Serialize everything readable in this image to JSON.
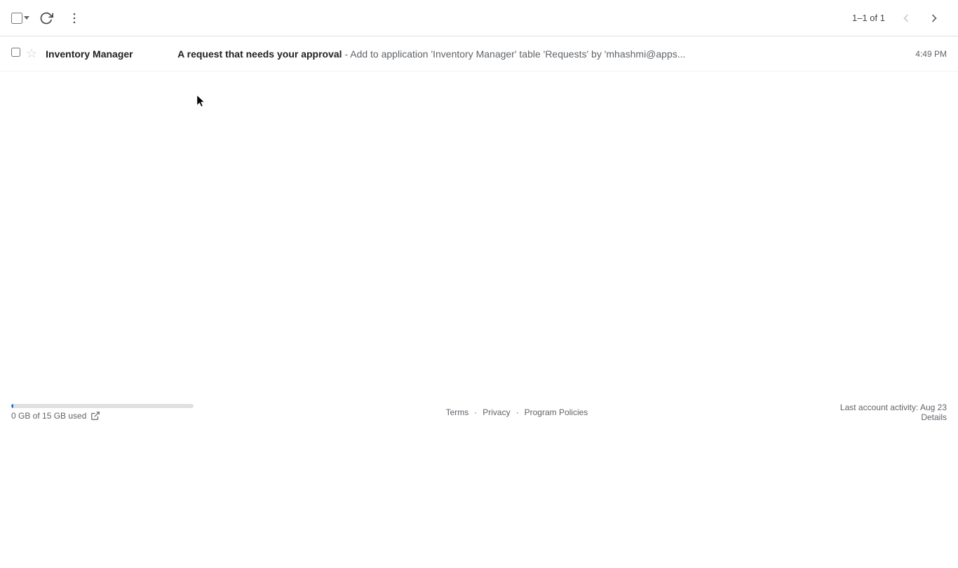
{
  "toolbar": {
    "refresh_label": "Refresh",
    "more_options_label": "More options",
    "pagination": "1–1 of 1",
    "prev_page_label": "Previous page",
    "next_page_label": "Next page"
  },
  "email": {
    "sender": "Inventory Manager",
    "subject": "A request that needs your approval",
    "preview": " - Add to application 'Inventory Manager' table 'Requests' by 'mhashmi@apps...",
    "time": "4:49 PM",
    "is_starred": false,
    "is_read": false
  },
  "footer": {
    "storage_used": "0 GB of 15 GB used",
    "storage_percent": 1,
    "terms_label": "Terms",
    "privacy_label": "Privacy",
    "program_policies_label": "Program Policies",
    "last_activity": "Last account activity: Aug 23",
    "details_label": "Details"
  }
}
